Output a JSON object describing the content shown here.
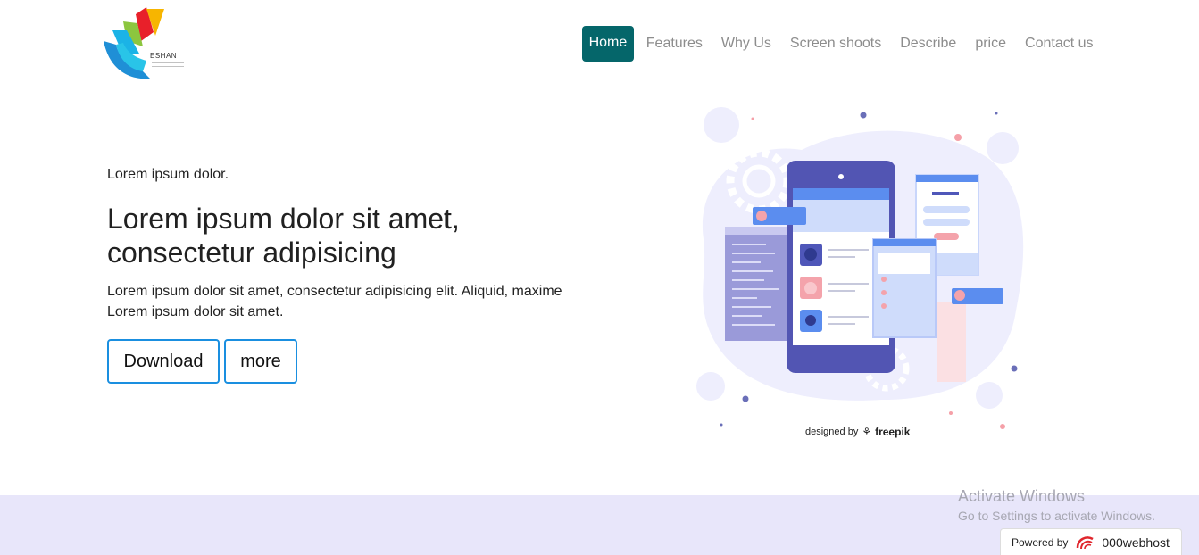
{
  "logo": {
    "brand": "ESHAN"
  },
  "nav": {
    "items": [
      {
        "label": "Home",
        "active": true
      },
      {
        "label": "Features"
      },
      {
        "label": "Why Us"
      },
      {
        "label": "Screen shoots"
      },
      {
        "label": "Describe"
      },
      {
        "label": "price"
      },
      {
        "label": "Contact us"
      }
    ]
  },
  "hero": {
    "eyebrow": "Lorem ipsum dolor.",
    "title_line1": "Lorem ipsum dolor sit amet,",
    "title_line2": "consectetur adipisicing",
    "body": "Lorem ipsum dolor sit amet, consectetur adipisicing elit. Aliquid, maxime Lorem ipsum dolor sit amet.",
    "download_label": "Download",
    "more_label": "more"
  },
  "illustration": {
    "credit_prefix": "designed by",
    "credit_brand": "freepik"
  },
  "os_watermark": {
    "line1": "Activate Windows",
    "line2": "Go to Settings to activate Windows."
  },
  "host_badge": {
    "prefix": "Powered by",
    "brand": "000webhost"
  },
  "colors": {
    "nav_active": "#05666a",
    "button_border": "#1a8fe0",
    "band": "#e8e6fa"
  }
}
